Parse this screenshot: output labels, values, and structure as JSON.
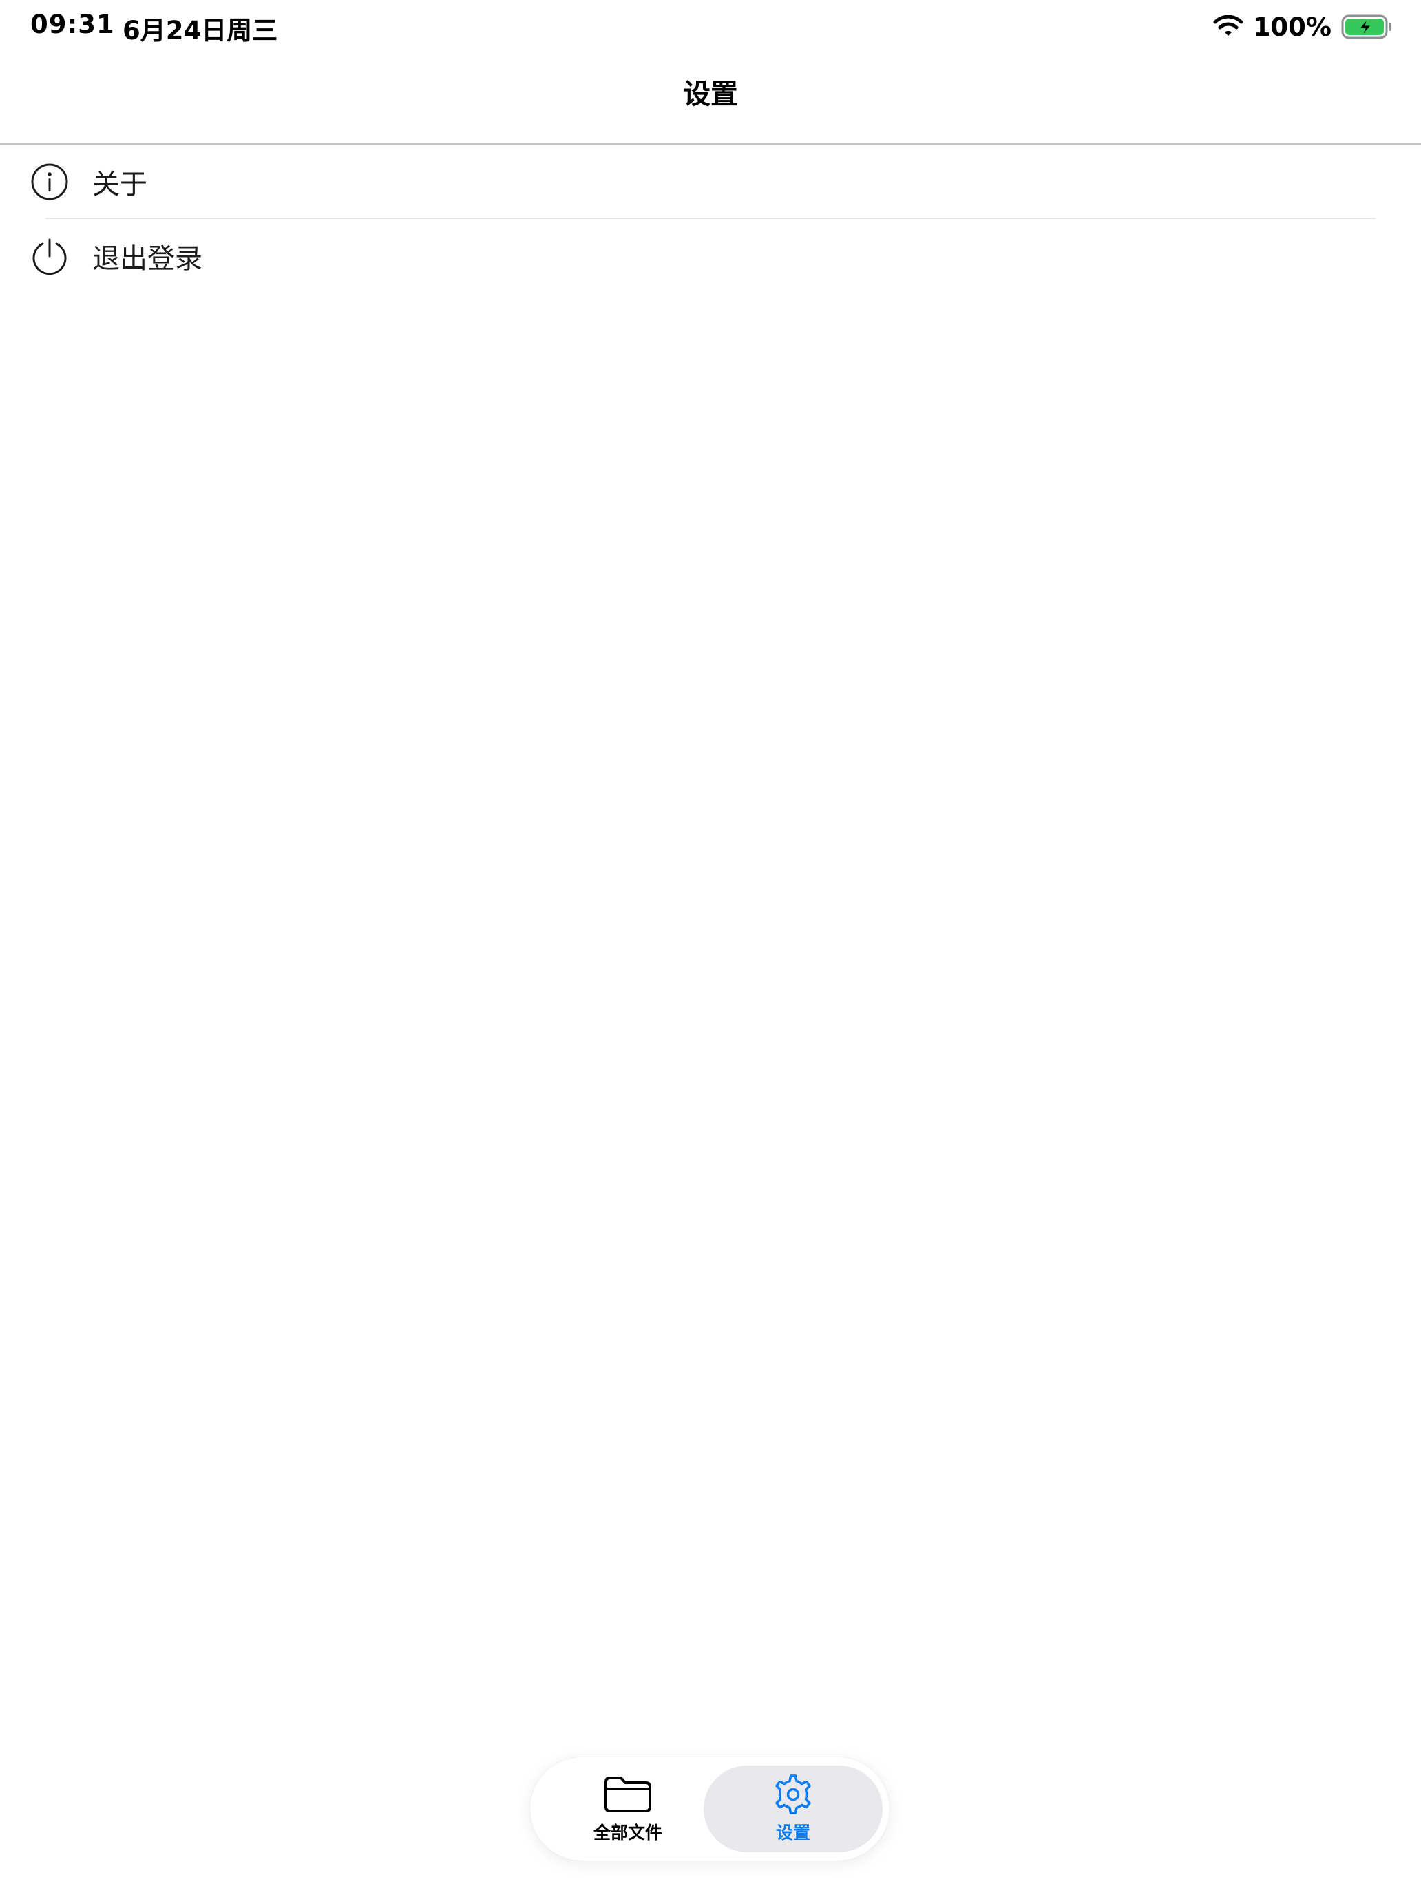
{
  "status_bar": {
    "time": "09:31",
    "date": "6月24日周三",
    "battery": "100%",
    "wifi_icon": "wifi-icon",
    "battery_icon": "battery-charging-icon"
  },
  "nav": {
    "title": "设置"
  },
  "settings": {
    "items": [
      {
        "label": "关于",
        "icon": "info-icon"
      },
      {
        "label": "退出登录",
        "icon": "power-icon"
      }
    ]
  },
  "tab_bar": {
    "tabs": [
      {
        "label": "全部文件",
        "icon": "folder-icon",
        "selected": false
      },
      {
        "label": "设置",
        "icon": "gear-icon",
        "selected": true
      }
    ]
  },
  "colors": {
    "accent": "#0a7bf2",
    "battery_fill": "#34c759",
    "separator": "#c6c6c8"
  }
}
